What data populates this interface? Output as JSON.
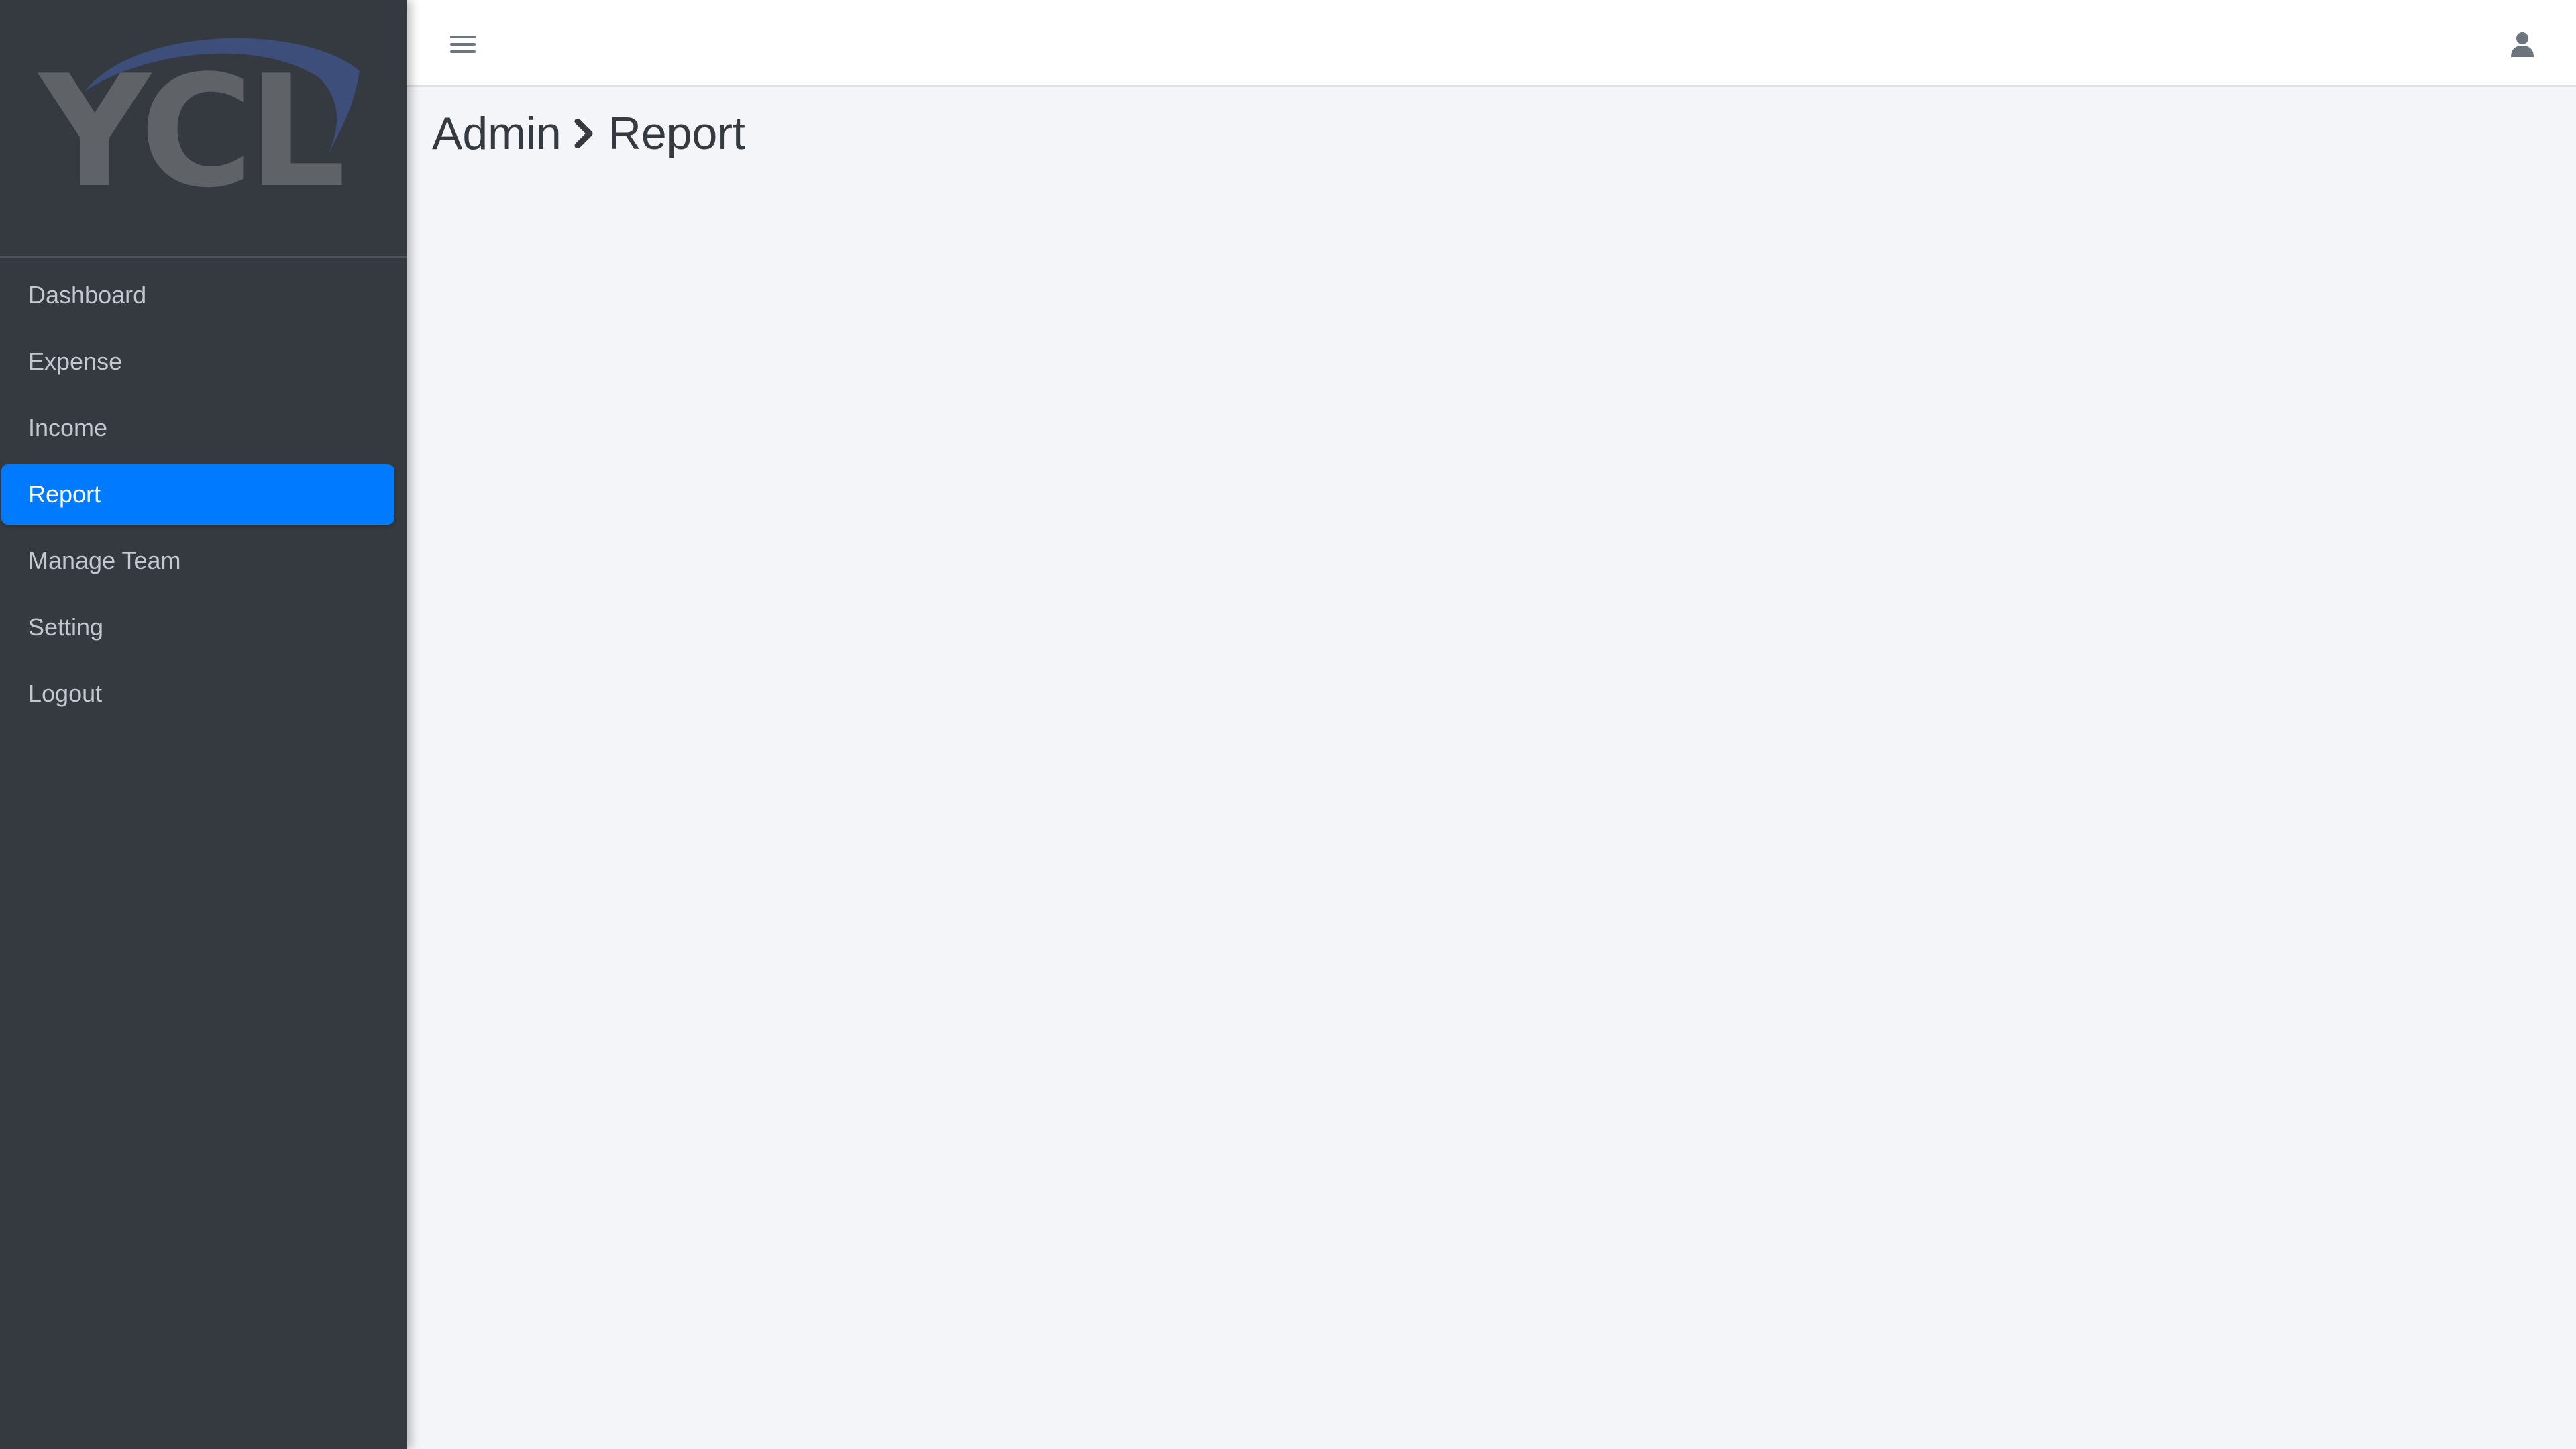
{
  "brand": {
    "logo_text": "YCL",
    "logo_icon": "ycl-logo"
  },
  "sidebar": {
    "items": [
      {
        "label": "Dashboard",
        "active": false
      },
      {
        "label": "Expense",
        "active": false
      },
      {
        "label": "Income",
        "active": false
      },
      {
        "label": "Report",
        "active": true
      },
      {
        "label": "Manage Team",
        "active": false
      },
      {
        "label": "Setting",
        "active": false
      },
      {
        "label": "Logout",
        "active": false
      }
    ]
  },
  "topbar": {
    "menu_icon": "hamburger-icon",
    "user_icon": "user-icon"
  },
  "breadcrumb": {
    "parent": "Admin",
    "separator_icon": "chevron-right-icon",
    "current": "Report"
  },
  "colors": {
    "sidebar_bg": "#343a40",
    "active_item": "#007bff",
    "content_bg": "#f4f5f9",
    "topbar_bg": "#ffffff",
    "nav_text": "#c2c7d0",
    "logo_gray": "#5f6368",
    "logo_swoosh": "#3d4e7a"
  }
}
